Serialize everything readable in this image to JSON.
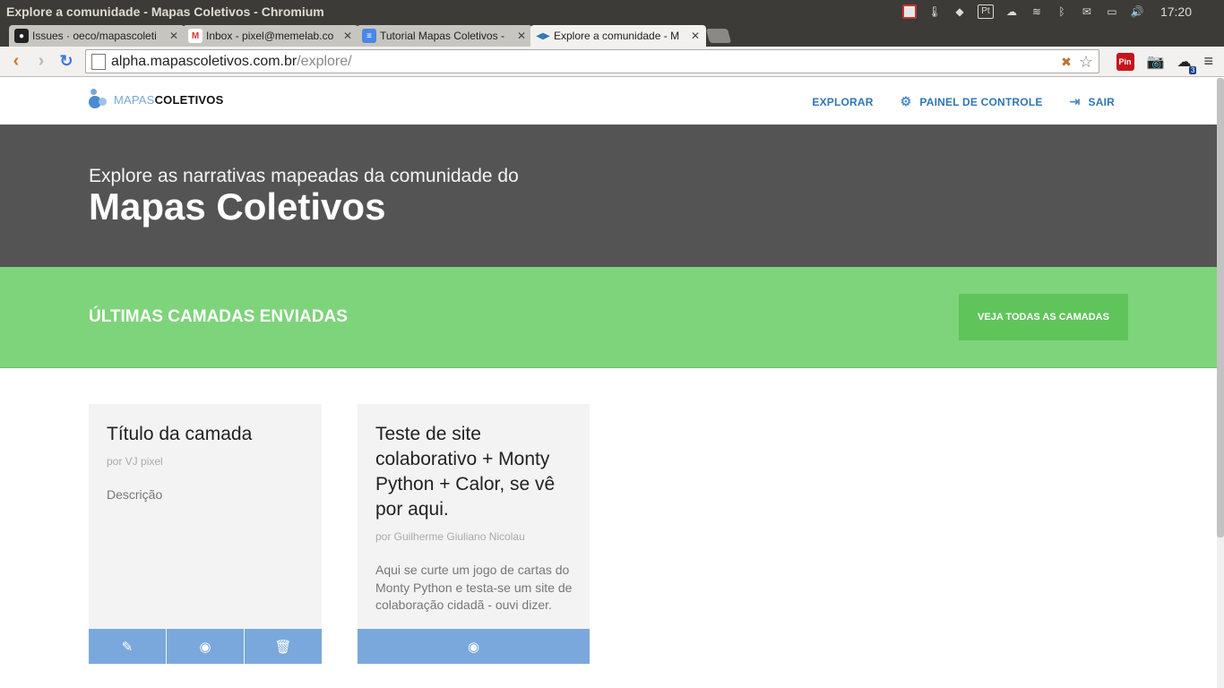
{
  "os": {
    "window_title": "Explore a comunidade - Mapas Coletivos - Chromium",
    "tray_pt": "Pt",
    "clock": "17:20"
  },
  "tabs": [
    {
      "title": "Issues · oeco/mapascoleti",
      "icon": "github-icon"
    },
    {
      "title": "Inbox - pixel@memelab.co",
      "icon": "gmail-icon"
    },
    {
      "title": "Tutorial Mapas Coletivos -",
      "icon": "docs-icon"
    },
    {
      "title": "Explore a comunidade - M",
      "icon": "mapas-icon"
    }
  ],
  "toolbar": {
    "url_host": "alpha.mapascoletivos.com.br",
    "url_path": "/explore/",
    "ext_pin": "Pin",
    "ext_badge": "3"
  },
  "site": {
    "logo_light": "MAPAS",
    "logo_bold": "COLETIVOS",
    "nav": [
      {
        "label": "EXPLORAR"
      },
      {
        "label": "PAINEL DE CONTROLE",
        "icon": "gear-icon"
      },
      {
        "label": "SAIR",
        "icon": "sign-out-icon"
      }
    ],
    "hero_subtitle": "Explore as narrativas mapeadas da comunidade do",
    "hero_title": "Mapas Coletivos",
    "band_title": "ÚLTIMAS CAMADAS ENVIADAS",
    "band_button": "VEJA TODAS AS CAMADAS"
  },
  "cards": [
    {
      "title": "Título da camada",
      "author": "por VJ pixel",
      "description": "Descrição",
      "actions": [
        "pencil-icon",
        "eye-icon",
        "trash-icon"
      ]
    },
    {
      "title": "Teste de site colaborativo + Monty Python + Calor, se vê por aqui.",
      "author": "por Guilherme Giuliano Nicolau",
      "description": "Aqui se curte um jogo de cartas do Monty Python e testa-se um site de colaboração cidadã - ouvi dizer.",
      "actions": [
        "eye-icon"
      ]
    }
  ],
  "colors": {
    "hero_bg": "#545454",
    "band_bg": "#7ed47a",
    "band_button": "#5fc55a",
    "card_action": "#7aa8dd",
    "nav_link": "#2f76b8"
  }
}
